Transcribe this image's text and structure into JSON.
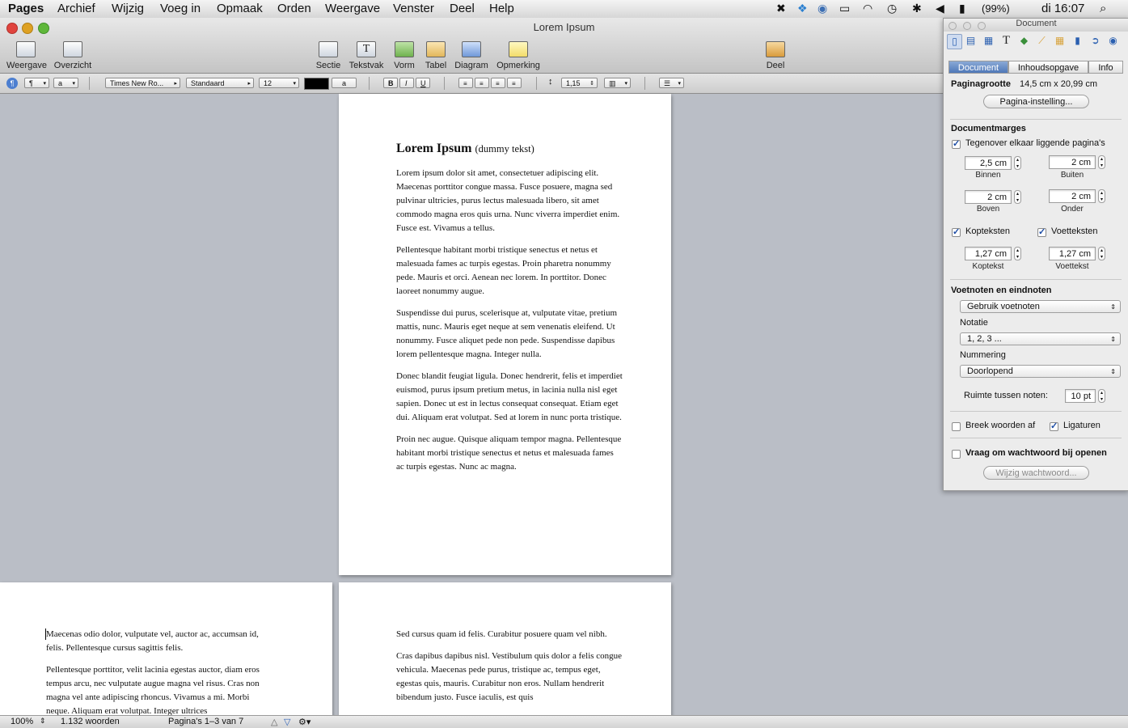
{
  "menubar": {
    "app": "Pages",
    "items": [
      "Archief",
      "Wijzig",
      "Voeg in",
      "Opmaak",
      "Orden",
      "Weergave",
      "Venster",
      "Deel",
      "Help"
    ],
    "battery": "(99%)",
    "clock": "di 16:07"
  },
  "window": {
    "title": "Lorem Ipsum"
  },
  "toolbar": {
    "weergave": "Weergave",
    "overzicht": "Overzicht",
    "sectie": "Sectie",
    "tekstvak": "Tekstvak",
    "vorm": "Vorm",
    "tabel": "Tabel",
    "diagram": "Diagram",
    "opmerking": "Opmerking",
    "deel": "Deel"
  },
  "formatbar": {
    "paragraph_style": "¶",
    "char_style": "a",
    "font": "Times New Ro...",
    "typeface": "Standaard",
    "size": "12",
    "bg_letter": "a",
    "bold": "B",
    "italic": "I",
    "underline": "U",
    "line_spacing": "1,15"
  },
  "document": {
    "page1": {
      "heading": "Lorem Ipsum",
      "heading_sub": "(dummy tekst)",
      "paragraphs": [
        "Lorem ipsum dolor sit amet, consectetuer adipiscing elit. Maecenas porttitor congue massa. Fusce posuere, magna sed pulvinar ultricies, purus lectus malesuada libero, sit amet commodo magna eros quis urna. Nunc viverra imperdiet enim. Fusce est. Vivamus a tellus.",
        "Pellentesque habitant morbi tristique senectus et netus et malesuada fames ac turpis egestas. Proin pharetra nonummy pede. Mauris et orci. Aenean nec lorem. In porttitor. Donec laoreet nonummy augue.",
        "Suspendisse dui purus, scelerisque at, vulputate vitae, pretium mattis, nunc. Mauris eget neque at sem venenatis eleifend. Ut nonummy. Fusce aliquet pede non pede. Suspendisse dapibus lorem pellentesque magna. Integer nulla.",
        "Donec blandit feugiat ligula. Donec hendrerit, felis et imperdiet euismod, purus ipsum pretium metus, in lacinia nulla nisl eget sapien. Donec ut est in lectus consequat consequat. Etiam eget dui. Aliquam erat volutpat. Sed at lorem in nunc porta tristique.",
        "Proin nec augue. Quisque aliquam tempor magna. Pellentesque habitant morbi tristique senectus et netus et malesuada fames ac turpis egestas. Nunc ac magna."
      ]
    },
    "page2": {
      "paragraphs": [
        "Maecenas odio dolor, vulputate vel, auctor ac, accumsan id, felis. Pellentesque cursus sagittis felis.",
        "Pellentesque porttitor, velit lacinia egestas auctor, diam eros tempus arcu, nec vulputate augue magna vel risus. Cras non magna vel ante adipiscing rhoncus. Vivamus a mi. Morbi neque. Aliquam erat volutpat. Integer ultrices"
      ]
    },
    "page3": {
      "paragraphs": [
        "Sed cursus quam id felis. Curabitur posuere quam vel nibh.",
        "Cras dapibus dapibus nisl. Vestibulum quis dolor a felis congue vehicula. Maecenas pede purus, tristique ac, tempus eget, egestas quis, mauris. Curabitur non eros. Nullam hendrerit bibendum justo. Fusce iaculis, est quis"
      ]
    }
  },
  "statusbar": {
    "zoom": "100%",
    "words": "1.132 woorden",
    "pages": "Pagina's 1–3 van 7"
  },
  "inspector": {
    "title": "Document",
    "tabs": [
      "Document",
      "Inhoudsopgave",
      "Info"
    ],
    "page_size_label": "Paginagrootte",
    "page_size_value": "14,5 cm x 20,99 cm",
    "page_setup_button": "Pagina-instelling...",
    "margins_heading": "Documentmarges",
    "facing_pages_label": "Tegenover elkaar liggende pagina's",
    "margin_inner": "2,5 cm",
    "margin_inner_label": "Binnen",
    "margin_outer": "2 cm",
    "margin_outer_label": "Buiten",
    "margin_top": "2 cm",
    "margin_top_label": "Boven",
    "margin_bottom": "2 cm",
    "margin_bottom_label": "Onder",
    "headers_label": "Kopteksten",
    "footers_label": "Voetteksten",
    "header_value": "1,27 cm",
    "header_sub": "Koptekst",
    "footer_value": "1,27 cm",
    "footer_sub": "Voettekst",
    "footnotes_heading": "Voetnoten en eindnoten",
    "footnote_mode": "Gebruik voetnoten",
    "notation_label": "Notatie",
    "notation_value": "1, 2, 3 ...",
    "numbering_label": "Nummering",
    "numbering_value": "Doorlopend",
    "space_label": "Ruimte tussen noten:",
    "space_value": "10 pt",
    "hyphenate_label": "Breek woorden af",
    "ligatures_label": "Ligaturen",
    "password_label": "Vraag om wachtwoord bij openen",
    "change_password_button": "Wijzig wachtwoord..."
  }
}
